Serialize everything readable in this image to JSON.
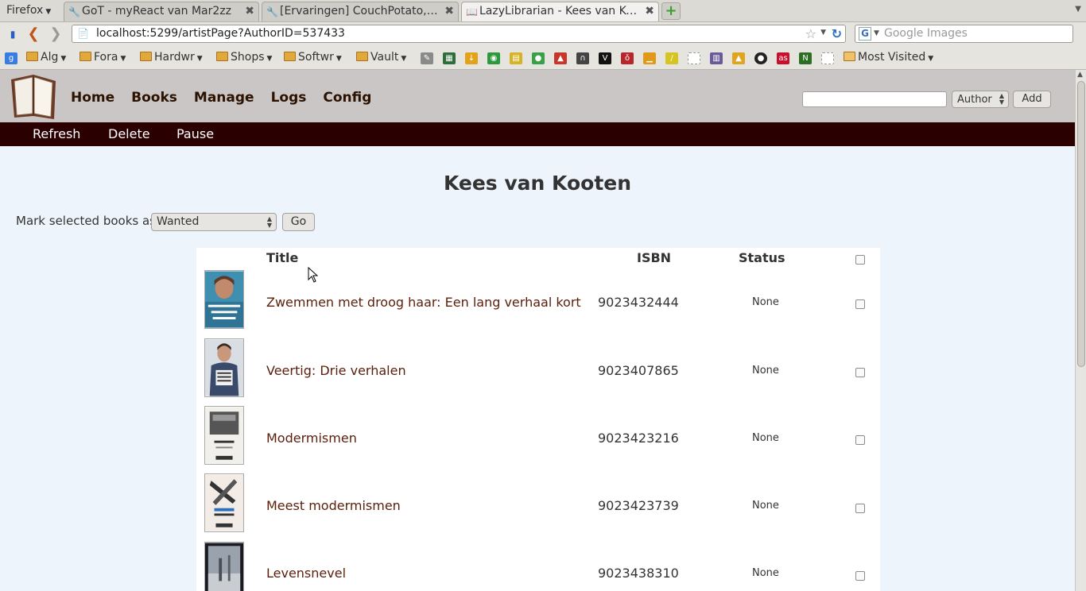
{
  "browser": {
    "menu_label": "Firefox",
    "tabs": [
      {
        "label": "GoT - myReact van Mar2zz",
        "active": false
      },
      {
        "label": "[Ervaringen] CouchPotato, ...",
        "active": false
      },
      {
        "label": "LazyLibrarian - Kees van Ko...",
        "active": true
      }
    ],
    "url": "localhost:5299/artistPage?AuthorID=537433",
    "search_placeholder": "Google Images",
    "bookmarks": {
      "folders": [
        "Alg",
        "Fora",
        "Hardwr",
        "Shops",
        "Softwr",
        "Vault"
      ],
      "most_visited": "Most Visited"
    }
  },
  "app": {
    "nav": [
      "Home",
      "Books",
      "Manage",
      "Logs",
      "Config"
    ],
    "search_type": "Author",
    "add_label": "Add",
    "subnav": [
      "Refresh",
      "Delete",
      "Pause"
    ],
    "author_name": "Kees van Kooten",
    "mark_label": "Mark selected books as",
    "mark_value": "Wanted",
    "go_label": "Go",
    "table": {
      "headers": {
        "title": "Title",
        "isbn": "ISBN",
        "status": "Status"
      },
      "rows": [
        {
          "title": "Zwemmen met droog haar: Een lang verhaal kort",
          "isbn": "9023432444",
          "status": "None"
        },
        {
          "title": "Veertig: Drie verhalen",
          "isbn": "9023407865",
          "status": "None"
        },
        {
          "title": "Modermismen",
          "isbn": "9023423216",
          "status": "None"
        },
        {
          "title": "Meest modermismen",
          "isbn": "9023423739",
          "status": "None"
        },
        {
          "title": "Levensnevel",
          "isbn": "9023438310",
          "status": "None"
        }
      ]
    }
  }
}
